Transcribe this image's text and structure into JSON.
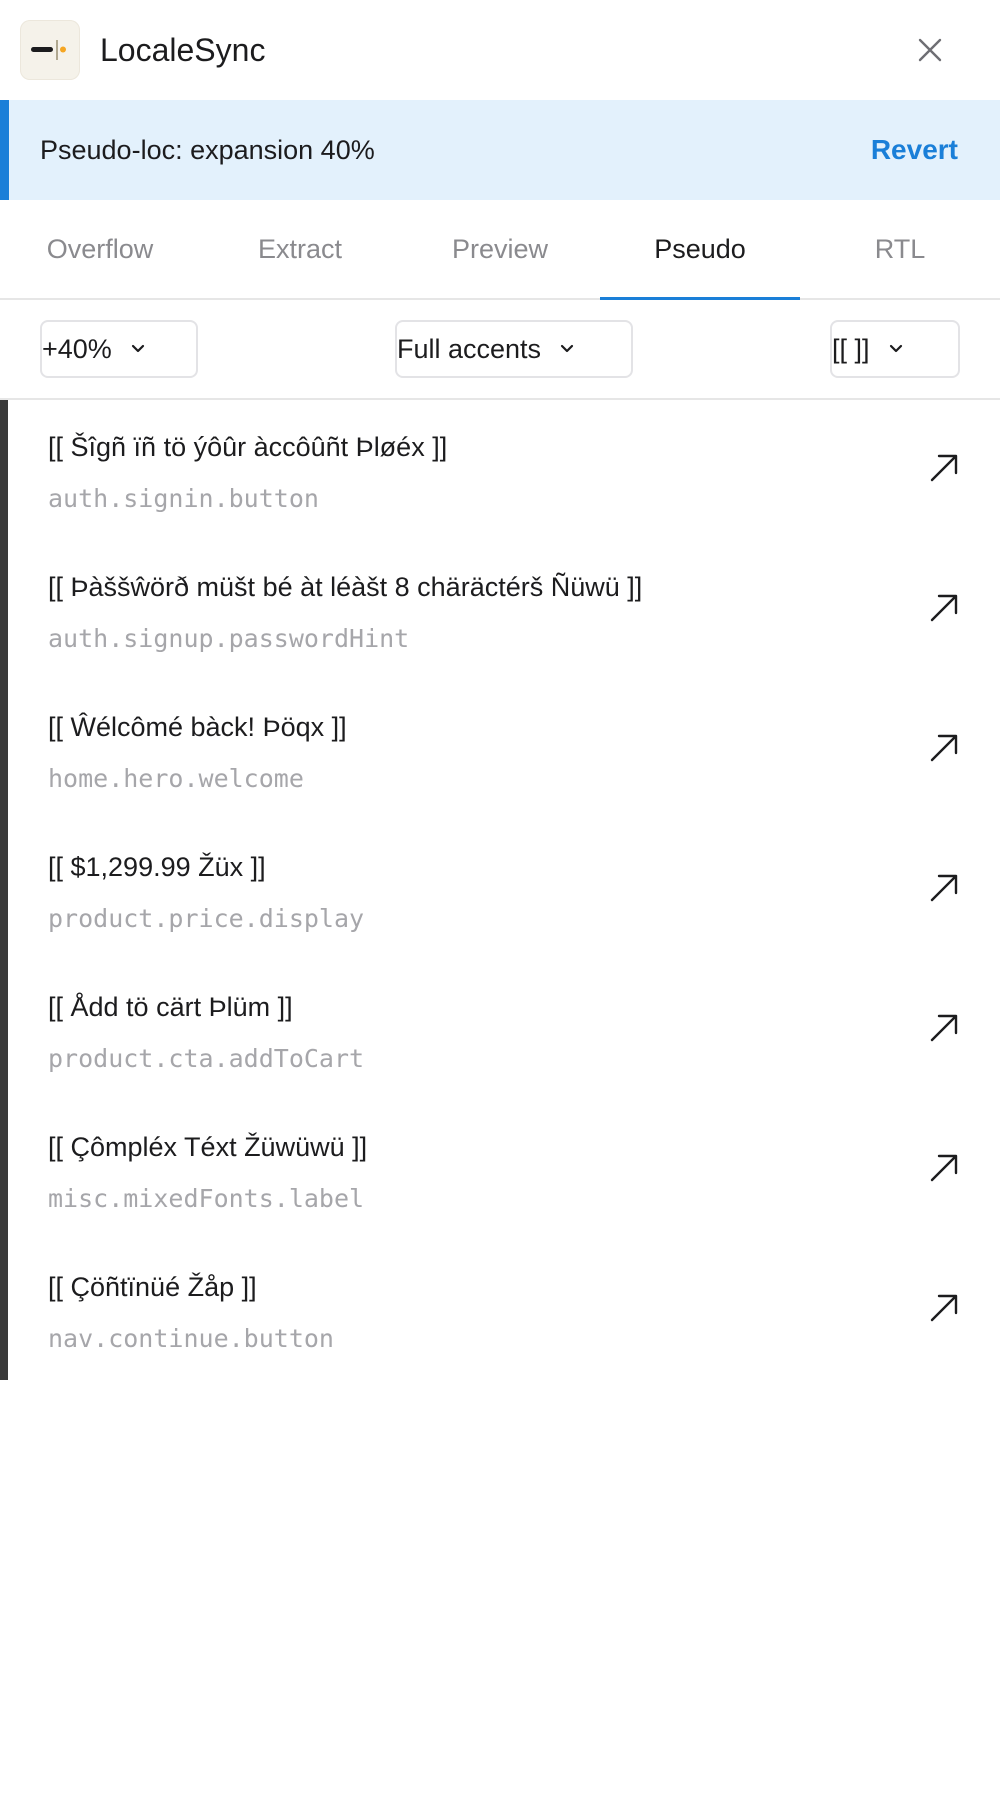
{
  "app": {
    "title": "LocaleSync",
    "logo_icon": "bracket-cursor-logo",
    "close_icon": "close-icon"
  },
  "banner": {
    "text": "Pseudo-loc: expansion 40%",
    "action": "Revert",
    "accent_color": "#1a7fd8",
    "background": "#e3f1fc"
  },
  "tabs": [
    {
      "label": "Overflow",
      "active": false
    },
    {
      "label": "Extract",
      "active": false
    },
    {
      "label": "Preview",
      "active": false
    },
    {
      "label": "Pseudo",
      "active": true
    },
    {
      "label": "RTL",
      "active": false
    }
  ],
  "filters": {
    "expansion": "+40%",
    "accents": "Full accents",
    "brackets": "[[ ]]"
  },
  "rows": [
    {
      "text": "[[ Šîgñ ïñ tö ýôûr àccôûñt Þløéx ]]",
      "key": "auth.signin.button"
    },
    {
      "text": "[[ Þàššŵörð müšt bé àt léàšt 8 chäräctérš Ñüwü ]]",
      "key": "auth.signup.passwordHint"
    },
    {
      "text": "[[ Ŵélcômé bàck! Þöqx ]]",
      "key": "home.hero.welcome"
    },
    {
      "text": "[[ $1,299.99 Žüx ]]",
      "key": "product.price.display"
    },
    {
      "text": "[[ Ådd tö cärt Þlüm ]]",
      "key": "product.cta.addToCart"
    },
    {
      "text": "[[ Çômpléx Téxt Žüwüwü ]]",
      "key": "misc.mixedFonts.label"
    },
    {
      "text": "[[ Çöñtïnüé Žåp ]]",
      "key": "nav.continue.button"
    }
  ]
}
